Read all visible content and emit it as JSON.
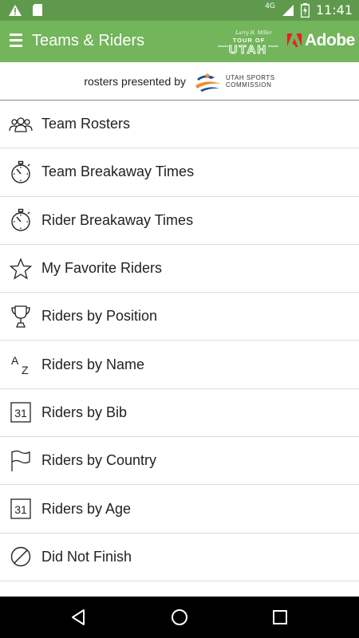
{
  "status_bar": {
    "network": "4G",
    "time": "11:41"
  },
  "app_bar": {
    "title": "Teams & Riders",
    "menu_icon": "hamburger-icon",
    "logos": {
      "tour": {
        "small": "Larry H. Miller",
        "line1": "TOUR OF",
        "line2": "UTAH"
      },
      "adobe": "Adobe"
    }
  },
  "sponsor": {
    "prefix": "rosters presented by",
    "logo_line1": "UTAH SPORTS",
    "logo_line2": "COMMISSION"
  },
  "menu_items": [
    {
      "label": "Team Rosters",
      "icon": "people-icon"
    },
    {
      "label": "Team Breakaway Times",
      "icon": "stopwatch-icon"
    },
    {
      "label": "Rider Breakaway Times",
      "icon": "stopwatch-icon"
    },
    {
      "label": "My Favorite Riders",
      "icon": "star-icon"
    },
    {
      "label": "Riders by Position",
      "icon": "trophy-icon"
    },
    {
      "label": "Riders by Name",
      "icon": "az-sort-icon",
      "glyph_a": "A",
      "glyph_z": "Z"
    },
    {
      "label": "Riders by Bib",
      "icon": "calendar-31-icon",
      "glyph": "31"
    },
    {
      "label": "Riders by Country",
      "icon": "flag-icon"
    },
    {
      "label": "Riders by Age",
      "icon": "calendar-31-icon",
      "glyph": "31"
    },
    {
      "label": "Did Not Finish",
      "icon": "prohibited-icon"
    }
  ],
  "colors": {
    "status_bar": "#5f9a4c",
    "app_bar": "#72b55b",
    "nav_bar": "#000000",
    "divider": "#dcdcdc"
  }
}
